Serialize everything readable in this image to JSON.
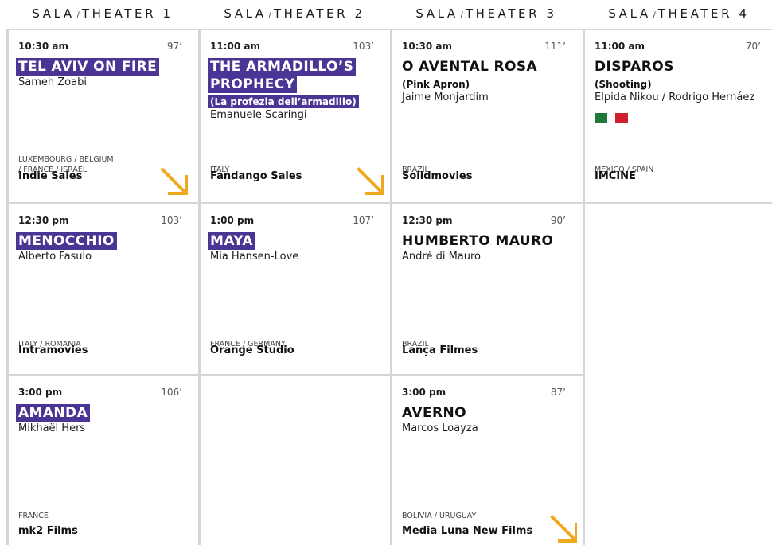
{
  "colors": {
    "highlight": "#4b3594",
    "arrow": "#f0a81e",
    "grid": "#d6d6d6",
    "flag_mexico": "#1f7a3a",
    "flag_mexico_white": "#ffffff",
    "flag_mexico_red": "#d01f2f"
  },
  "theaters": [
    {
      "sala": "SALA",
      "slash": "/",
      "name": "THEATER 1"
    },
    {
      "sala": "SALA",
      "slash": "/",
      "name": "THEATER 2"
    },
    {
      "sala": "SALA",
      "slash": "/",
      "name": "THEATER 3"
    },
    {
      "sala": "SALA",
      "slash": "/",
      "name": "THEATER 4"
    }
  ],
  "screenings": [
    {
      "theater": 1,
      "time": "10:30 am",
      "runtime": "97’",
      "title": "TEL AVIV ON FIRE",
      "subtitle": "",
      "director": "Sameh Zoabi",
      "country_lines": [
        "LUXEMBOURG / BELGIUM",
        "/ FRANCE / ISRAEL"
      ],
      "distributor": "Indie Sales",
      "arrow": true
    },
    {
      "theater": 2,
      "time": "11:00 am",
      "runtime": "103’",
      "title": "THE ARMADILLO’S PROPHECY",
      "subtitle": "(La profezia dell’armadillo)",
      "director": "Emanuele Scaringi",
      "country_lines": [
        "ITALY"
      ],
      "distributor": "Fandango Sales",
      "arrow": true
    },
    {
      "theater": 3,
      "time": "10:30 am",
      "runtime": "111’",
      "title": "O AVENTAL ROSA",
      "subtitle": "(Pink Apron)",
      "director": "Jaime Monjardim",
      "country_lines": [
        "BRAZIL"
      ],
      "distributor": "Solidmovies",
      "arrow": false
    },
    {
      "theater": 4,
      "time": "11:00 am",
      "runtime": "70’",
      "title": "DISPAROS",
      "subtitle": "(Shooting)",
      "director": "Elpida Nikou / Rodrigo Hernáez",
      "country_lines": [
        "MEXICO / SPAIN"
      ],
      "distributor": "IMCINE",
      "arrow": false
    },
    {
      "theater": 1,
      "time": "12:30 pm",
      "runtime": "103’",
      "title": "MENOCCHIO",
      "subtitle": "",
      "director": "Alberto Fasulo",
      "country_lines": [
        "ITALY / ROMANIA"
      ],
      "distributor": "Intramovies",
      "arrow": false
    },
    {
      "theater": 2,
      "time": "1:00 pm",
      "runtime": "107’",
      "title": "MAYA",
      "subtitle": "",
      "director": "Mia Hansen-Love",
      "country_lines": [
        "FRANCE / GERMANY"
      ],
      "distributor": "Orange Studio",
      "arrow": false
    },
    {
      "theater": 3,
      "time": "12:30 pm",
      "runtime": "90’",
      "title": "HUMBERTO MAURO",
      "subtitle": "",
      "director": "André di Mauro",
      "country_lines": [
        "BRAZIL"
      ],
      "distributor": "Lança Filmes",
      "arrow": false
    },
    {
      "theater": 1,
      "time": "3:00 pm",
      "runtime": "106’",
      "title": "AMANDA",
      "subtitle": "",
      "director": "Mikhaël Hers",
      "country_lines": [
        "FRANCE"
      ],
      "distributor": "mk2 Films",
      "arrow": false
    },
    {
      "theater": 3,
      "time": "3:00 pm",
      "runtime": "87’",
      "title": "AVERNO",
      "subtitle": "",
      "director": "Marcos Loayza",
      "country_lines": [
        "BOLIVIA / URUGUAY"
      ],
      "distributor": "Media Luna New Films",
      "arrow": true
    }
  ]
}
